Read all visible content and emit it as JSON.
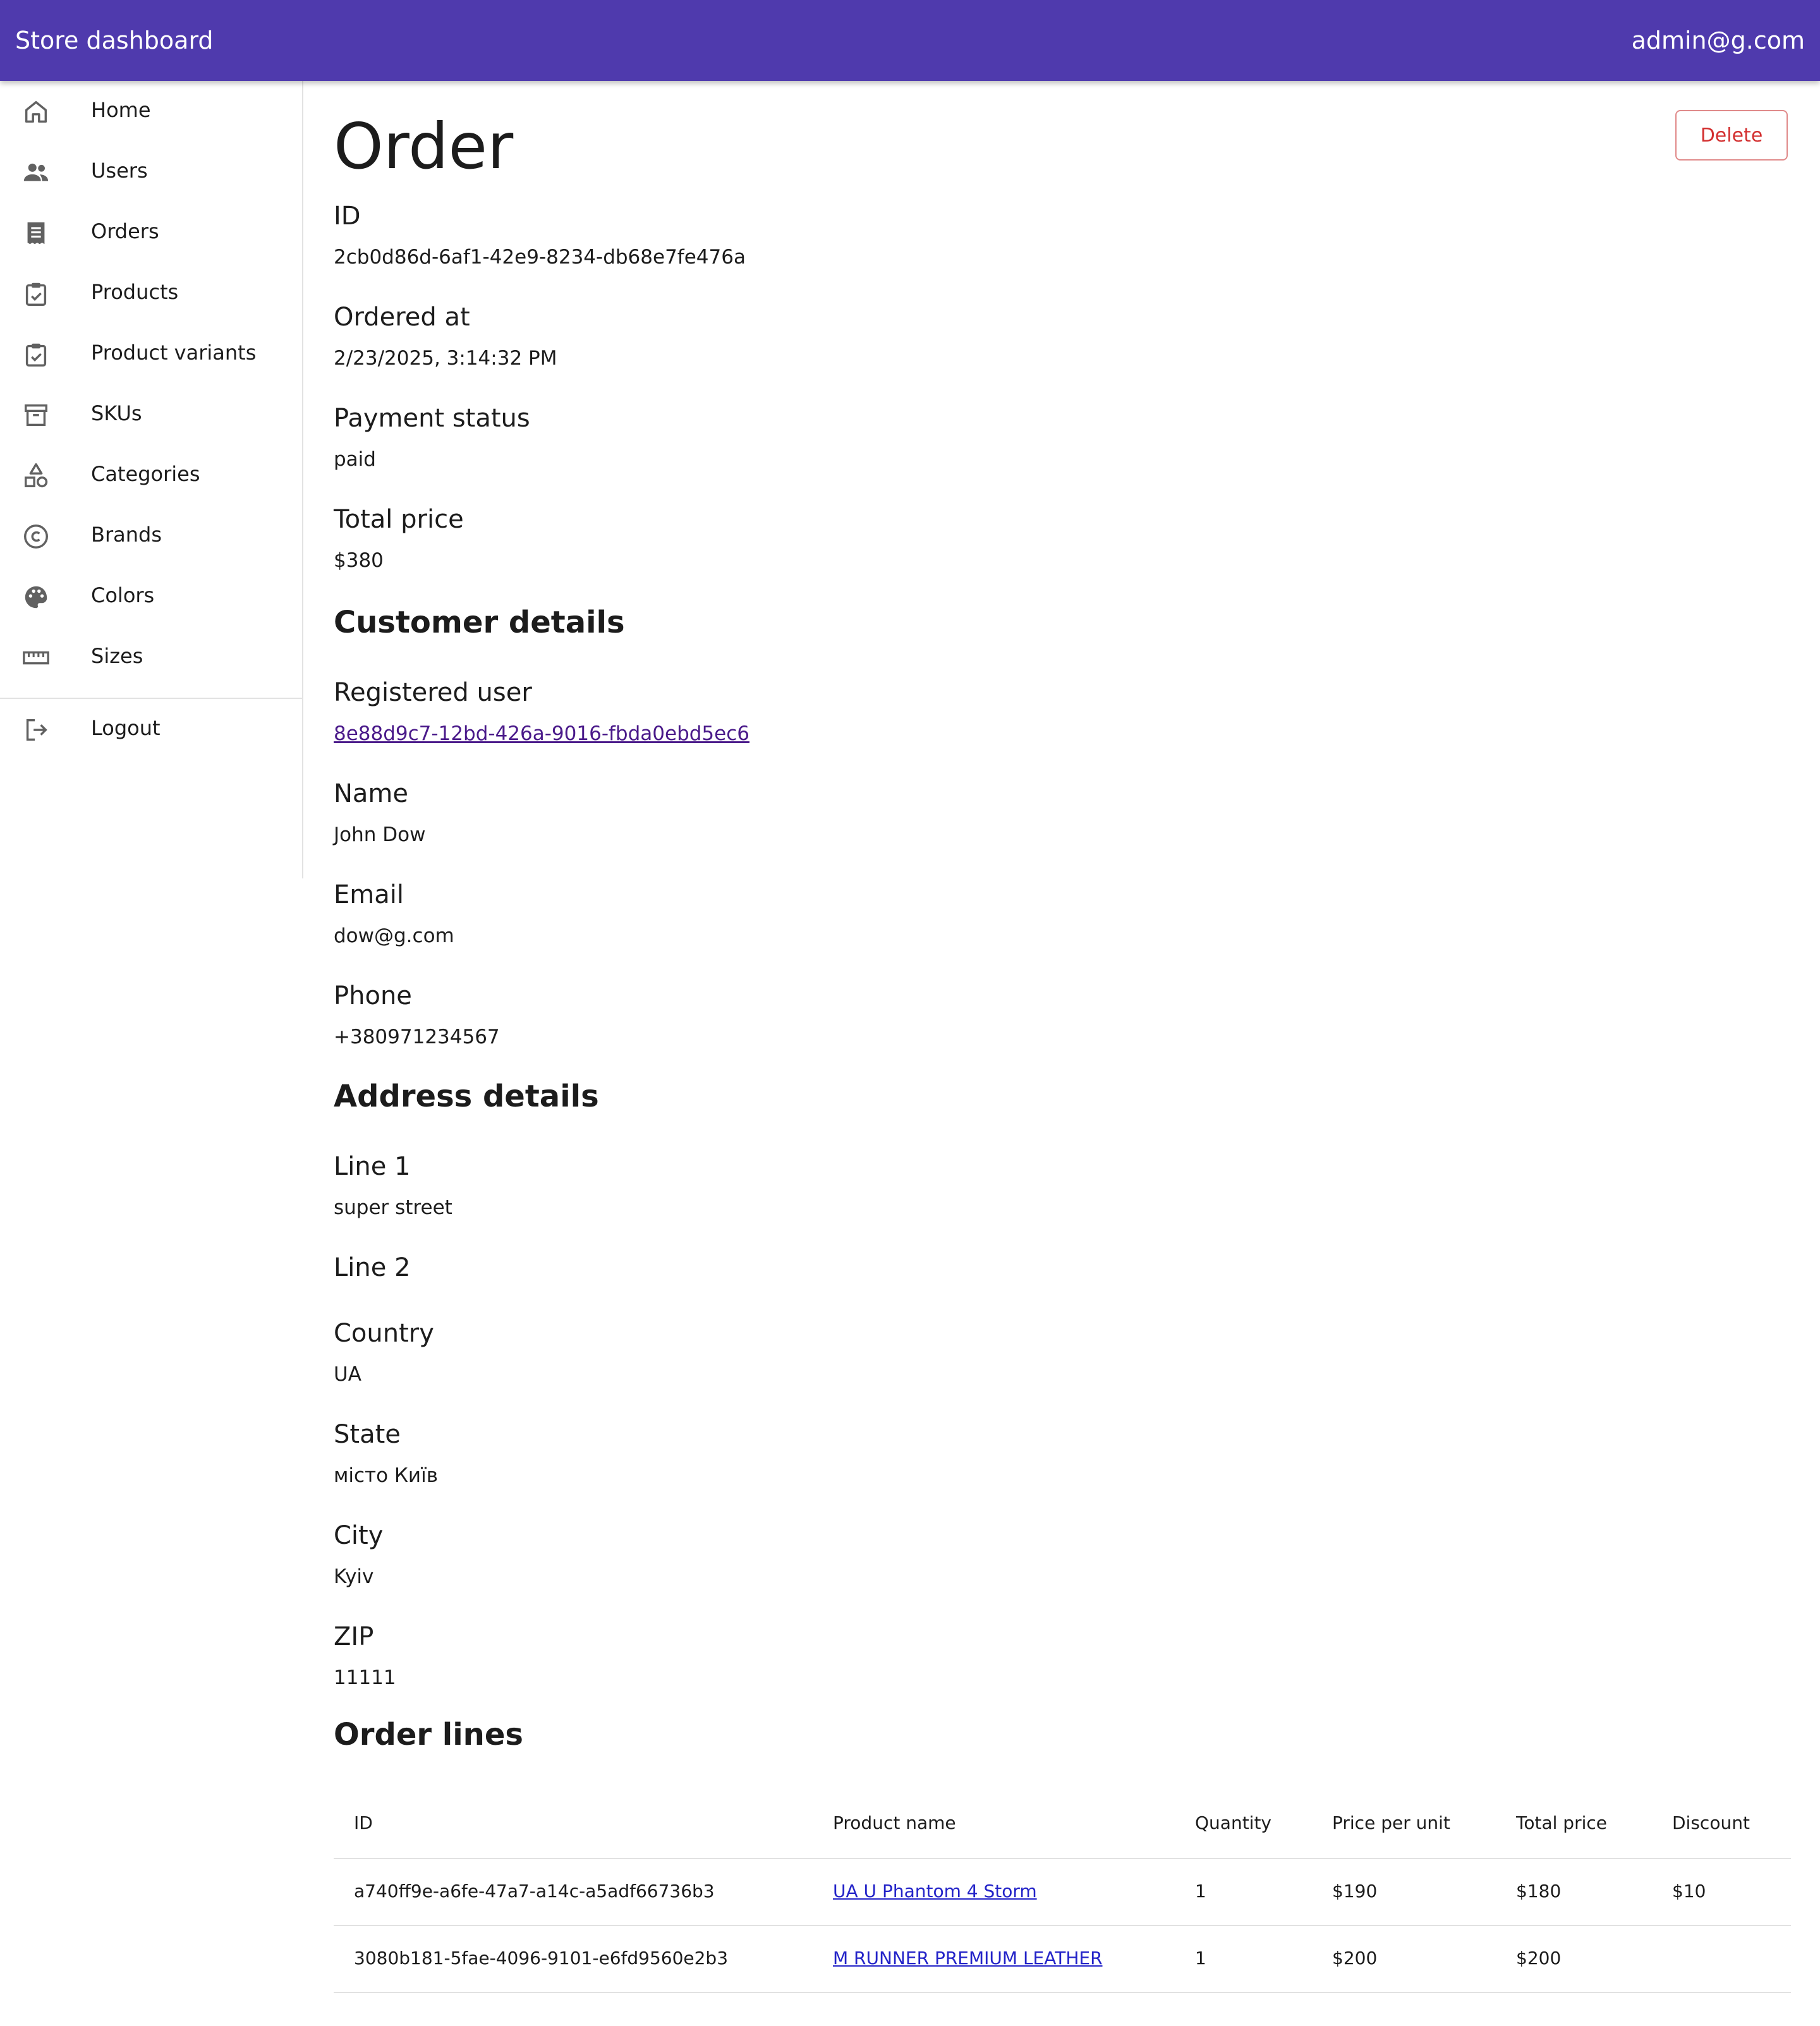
{
  "appbar": {
    "title": "Store dashboard",
    "user_email": "admin@g.com"
  },
  "sidebar": {
    "items": [
      {
        "label": "Home",
        "icon": "home-icon"
      },
      {
        "label": "Users",
        "icon": "users-icon"
      },
      {
        "label": "Orders",
        "icon": "receipt-icon"
      },
      {
        "label": "Products",
        "icon": "clipboard-check-icon"
      },
      {
        "label": "Product variants",
        "icon": "clipboard-check-icon"
      },
      {
        "label": "SKUs",
        "icon": "archive-icon"
      },
      {
        "label": "Categories",
        "icon": "shapes-icon"
      },
      {
        "label": "Brands",
        "icon": "copyright-icon"
      },
      {
        "label": "Colors",
        "icon": "palette-icon"
      },
      {
        "label": "Sizes",
        "icon": "ruler-icon"
      }
    ],
    "logout": {
      "label": "Logout",
      "icon": "logout-icon"
    }
  },
  "page": {
    "title": "Order",
    "delete_label": "Delete"
  },
  "order": {
    "id_label": "ID",
    "id": "2cb0d86d-6af1-42e9-8234-db68e7fe476a",
    "ordered_at_label": "Ordered at",
    "ordered_at": "2/23/2025, 3:14:32 PM",
    "payment_status_label": "Payment status",
    "payment_status": "paid",
    "total_price_label": "Total price",
    "total_price": "$380"
  },
  "customer": {
    "heading": "Customer details",
    "registered_user_label": "Registered user",
    "registered_user": "8e88d9c7-12bd-426a-9016-fbda0ebd5ec6",
    "name_label": "Name",
    "name": "John Dow",
    "email_label": "Email",
    "email": "dow@g.com",
    "phone_label": "Phone",
    "phone": "+380971234567"
  },
  "address": {
    "heading": "Address details",
    "line1_label": "Line 1",
    "line1": "super street",
    "line2_label": "Line 2",
    "line2": "",
    "country_label": "Country",
    "country": "UA",
    "state_label": "State",
    "state": "місто Київ",
    "city_label": "City",
    "city": "Kyiv",
    "zip_label": "ZIP",
    "zip": "11111"
  },
  "order_lines": {
    "heading": "Order lines",
    "columns": [
      "ID",
      "Product name",
      "Quantity",
      "Price per unit",
      "Total price",
      "Discount"
    ],
    "rows": [
      [
        "a740ff9e-a6fe-47a7-a14c-a5adf66736b3",
        "UA U Phantom 4 Storm",
        "1",
        "$190",
        "$180",
        "$10"
      ],
      [
        "3080b181-5fae-4096-9101-e6fd9560e2b3",
        "M RUNNER PREMIUM LEATHER",
        "1",
        "$200",
        "$200",
        ""
      ]
    ]
  },
  "colors": {
    "appbar": "#4f3aad",
    "danger": "#d32f2f",
    "link": "#2323c8"
  }
}
